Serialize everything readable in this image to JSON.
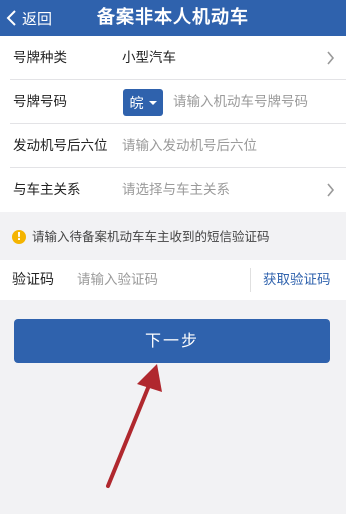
{
  "header": {
    "back_label": "返回",
    "title": "备案非本人机动车"
  },
  "form": {
    "plate_type": {
      "label": "号牌种类",
      "value": "小型汽车"
    },
    "plate_number": {
      "label": "号牌号码",
      "province": "皖",
      "placeholder": "请输入机动车号牌号码"
    },
    "engine": {
      "label": "发动机号后六位",
      "placeholder": "请输入发动机号后六位"
    },
    "relation": {
      "label": "与车主关系",
      "placeholder": "请选择与车主关系"
    }
  },
  "notice": "请输入待备案机动车车主收到的短信验证码",
  "verify": {
    "label": "验证码",
    "placeholder": "请输入验证码",
    "get_code": "获取验证码"
  },
  "next_button": "下一步",
  "colors": {
    "primary": "#2f62ad",
    "warning": "#f4b400",
    "annotation_arrow": "#b0282e"
  },
  "icons": [
    "back-chevron-icon",
    "chevron-right-icon",
    "caret-down-icon",
    "warning-icon",
    "annotation-arrow"
  ]
}
